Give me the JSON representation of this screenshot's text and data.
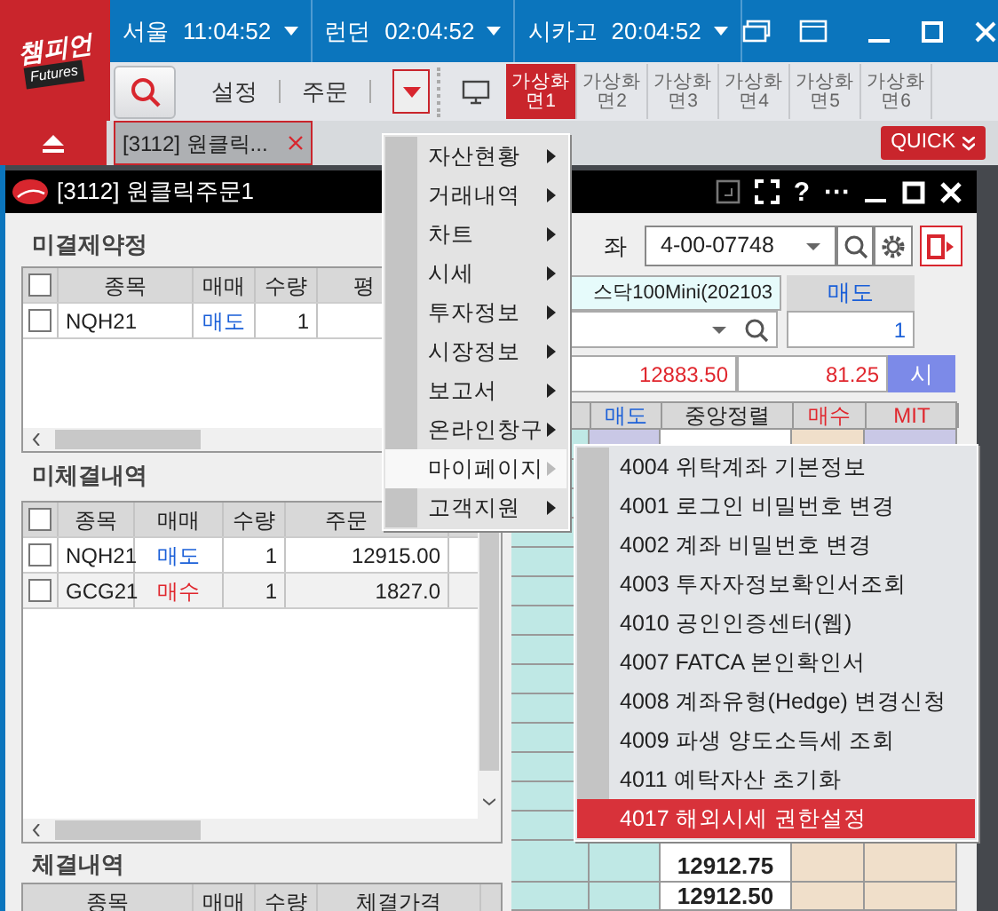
{
  "app": {
    "logo": "챔피언",
    "logo_sub": "Futures"
  },
  "clocks": [
    {
      "city": "서울",
      "time": "11:04:52"
    },
    {
      "city": "런던",
      "time": "02:04:52"
    },
    {
      "city": "시카고",
      "time": "20:04:52"
    }
  ],
  "toolbar": {
    "labels": [
      "설정",
      "주문"
    ]
  },
  "virtual_screens": [
    {
      "label": "가상화면1",
      "selected": true
    },
    {
      "label": "가상화면2",
      "selected": false
    },
    {
      "label": "가상화면3",
      "selected": false
    },
    {
      "label": "가상화면4",
      "selected": false
    },
    {
      "label": "가상화면5",
      "selected": false
    },
    {
      "label": "가상화면6",
      "selected": false
    }
  ],
  "tabs": [
    {
      "label": "[3112] 원클릭...",
      "selected": true
    }
  ],
  "quick_button": "QUICK",
  "inner_window": {
    "title": "[3112] 원클릭주문1",
    "help": "?",
    "more": "···"
  },
  "open_positions": {
    "title": "미결제약정",
    "all_checked": false,
    "columns": [
      "종목",
      "매매",
      "수량",
      "평"
    ],
    "rows": [
      {
        "checked": false,
        "symbol": "NQH21",
        "kind": "sell",
        "side_label": "매도",
        "qty": "1"
      }
    ]
  },
  "pending_orders": {
    "title": "미체결내역",
    "all_checked": false,
    "columns": [
      "종목",
      "매매",
      "수량",
      "주문"
    ],
    "rows": [
      {
        "checked": false,
        "symbol": "NQH21",
        "kind": "sell",
        "side_label": "매도",
        "qty": "1",
        "price": "12915.00"
      },
      {
        "checked": false,
        "symbol": "GCG21",
        "kind": "buy",
        "side_label": "매수",
        "qty": "1",
        "price": "1827.0"
      }
    ]
  },
  "executions": {
    "title": "체결내역",
    "columns": [
      "종목",
      "매매",
      "수량",
      "체결가격"
    ]
  },
  "order_panel": {
    "account_label": "좌",
    "account": "4-00-07748",
    "product": "스닥100Mini(202103",
    "sell_header": "매도",
    "sell_qty": "1",
    "price": "12883.50",
    "change": "81.25",
    "market_button": "시"
  },
  "order_grid": {
    "columns": [
      {
        "label": "매도",
        "color": "#1a5fd8"
      },
      {
        "label": "중앙정렬",
        "color": "#222222"
      },
      {
        "label": "매수",
        "color": "#e0262d"
      },
      {
        "label": "MIT",
        "color": "#e0262d"
      }
    ],
    "top_rows": [
      {
        "kind": "current"
      }
    ],
    "bottom_rows": [
      {
        "center": "12912.75"
      },
      {
        "center": "12912.50"
      }
    ]
  },
  "menu": {
    "items": [
      {
        "label": "자산현황",
        "has_submenu": true,
        "selected": false
      },
      {
        "label": "거래내역",
        "has_submenu": true,
        "selected": false
      },
      {
        "label": "차트",
        "has_submenu": true,
        "selected": false
      },
      {
        "label": "시세",
        "has_submenu": true,
        "selected": false
      },
      {
        "label": "투자정보",
        "has_submenu": true,
        "selected": false
      },
      {
        "label": "시장정보",
        "has_submenu": true,
        "selected": false
      },
      {
        "label": "보고서",
        "has_submenu": true,
        "selected": false
      },
      {
        "label": "온라인창구",
        "has_submenu": true,
        "selected": false
      },
      {
        "label": "마이페이지",
        "has_submenu": true,
        "selected": true
      },
      {
        "label": "고객지원",
        "has_submenu": true,
        "selected": false
      }
    ]
  },
  "submenu": {
    "items": [
      {
        "label": "4004 위탁계좌 기본정보",
        "selected": false
      },
      {
        "label": "4001 로그인 비밀번호 변경",
        "selected": false
      },
      {
        "label": "4002 계좌 비밀번호 변경",
        "selected": false
      },
      {
        "label": "4003 투자자정보확인서조회",
        "selected": false
      },
      {
        "label": "4010 공인인증센터(웹)",
        "selected": false
      },
      {
        "label": "4007 FATCA 본인확인서",
        "selected": false
      },
      {
        "label": "4008 계좌유형(Hedge) 변경신청",
        "selected": false
      },
      {
        "label": "4009 파생 양도소득세 조회",
        "selected": false
      },
      {
        "label": "4011 예탁자산 초기화",
        "selected": false
      },
      {
        "label": "4017 해외시세 권한설정",
        "selected": true
      }
    ]
  }
}
